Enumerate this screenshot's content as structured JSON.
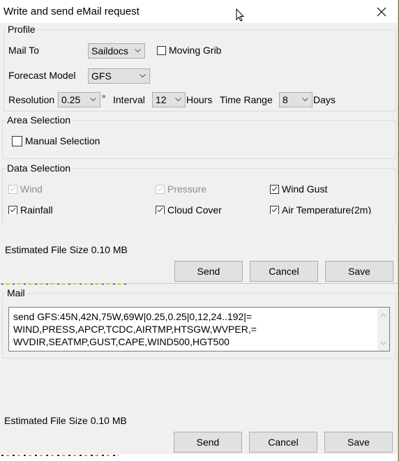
{
  "window": {
    "title": "Write and send eMail request",
    "close_icon": "close-icon"
  },
  "profile": {
    "label": "Profile",
    "mail_to_label": "Mail To",
    "mail_to_value": "Saildocs",
    "moving_grib_label": "Moving Grib",
    "moving_grib_checked": false,
    "forecast_model_label": "Forecast Model",
    "forecast_model_value": "GFS",
    "resolution_label": "Resolution",
    "resolution_value": "0.25",
    "resolution_unit": "°",
    "interval_label": "Interval",
    "interval_value": "12",
    "interval_unit": "Hours",
    "time_range_label": "Time Range",
    "time_range_value": "8",
    "time_range_unit": "Days"
  },
  "area_selection": {
    "label": "Area Selection",
    "manual_selection_label": "Manual Selection",
    "manual_selection_checked": false
  },
  "data_selection": {
    "label": "Data Selection",
    "items": [
      {
        "label": "Wind",
        "checked": true,
        "disabled": true
      },
      {
        "label": "Pressure",
        "checked": true,
        "disabled": true
      },
      {
        "label": "Wind Gust",
        "checked": true,
        "disabled": false
      },
      {
        "label": "Rainfall",
        "checked": true,
        "disabled": false
      },
      {
        "label": "Cloud Cover",
        "checked": true,
        "disabled": false
      },
      {
        "label": "Air Temperature(2m)",
        "checked": true,
        "disabled": false
      }
    ]
  },
  "upper_footer": {
    "estimated_size": "Estimated File Size 0.10 MB",
    "send_label": "Send",
    "cancel_label": "Cancel",
    "save_label": "Save"
  },
  "mail": {
    "label": "Mail",
    "body": "send GFS:45N,42N,75W,69W|0.25,0.25|0,12,24..192|=\nWIND,PRESS,APCP,TCDC,AIRTMP,HTSGW,WVPER,=\nWVDIR,SEATMP,GUST,CAPE,WIND500,HGT500"
  },
  "footer": {
    "estimated_size": "Estimated File Size 0.10 MB",
    "send_label": "Send",
    "cancel_label": "Cancel",
    "save_label": "Save"
  }
}
